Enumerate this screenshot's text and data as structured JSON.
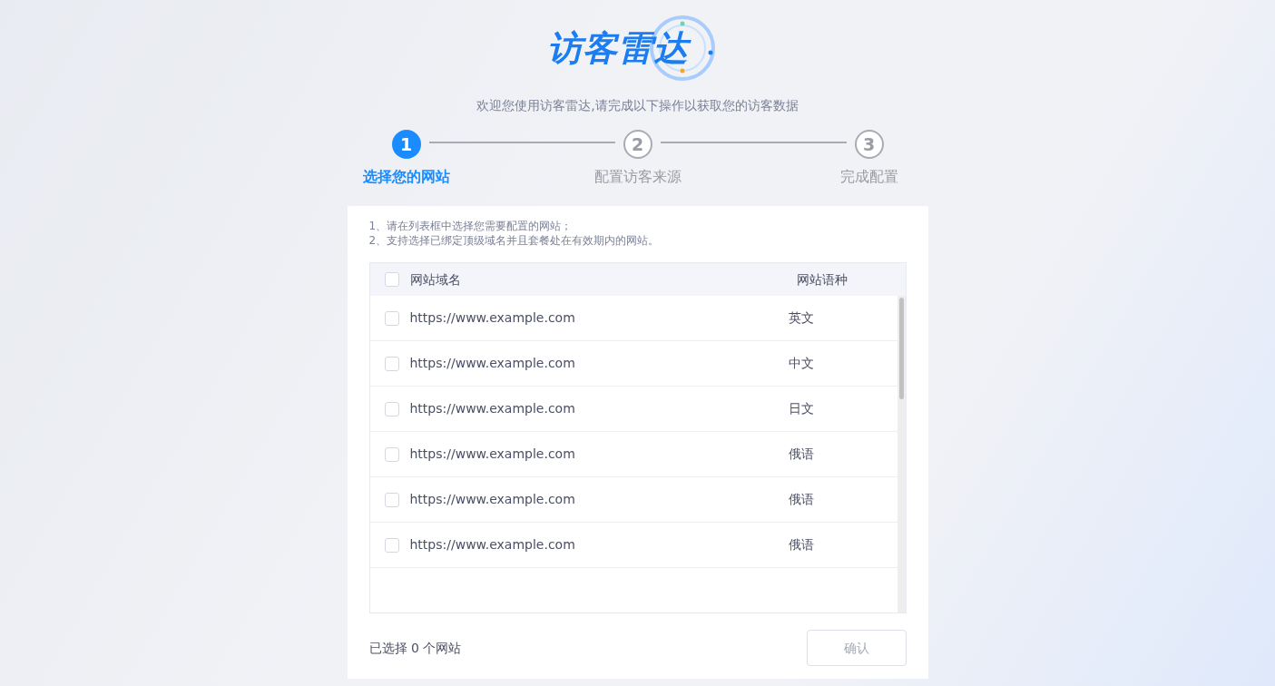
{
  "logo": {
    "text": "访客雷达"
  },
  "subtitle": "欢迎您使用访客雷达,请完成以下操作以获取您的访客数据",
  "steps": [
    {
      "number": "1",
      "label": "选择您的网站",
      "selected": true
    },
    {
      "number": "2",
      "label": "配置访客来源",
      "selected": false
    },
    {
      "number": "3",
      "label": "完成配置",
      "selected": false
    }
  ],
  "instructions": [
    "1、请在列表框中选择您需要配置的网站；",
    "2、支持选择已绑定顶级域名并且套餐处在有效期内的网站。"
  ],
  "table": {
    "select_all_checked": false,
    "columns": [
      "网站域名",
      "网站语种"
    ],
    "rows": [
      {
        "domain": "https://www.example.com",
        "language": "英文",
        "checked": false
      },
      {
        "domain": "https://www.example.com",
        "language": "中文",
        "checked": false
      },
      {
        "domain": "https://www.example.com",
        "language": "日文",
        "checked": false
      },
      {
        "domain": "https://www.example.com",
        "language": "俄语",
        "checked": false
      },
      {
        "domain": "https://www.example.com",
        "language": "俄语",
        "checked": false
      },
      {
        "domain": "https://www.example.com",
        "language": "俄语",
        "checked": false
      }
    ]
  },
  "selection_summary": "已选择 0 个网站",
  "confirm_button": {
    "label": "确认",
    "disabled": true
  }
}
